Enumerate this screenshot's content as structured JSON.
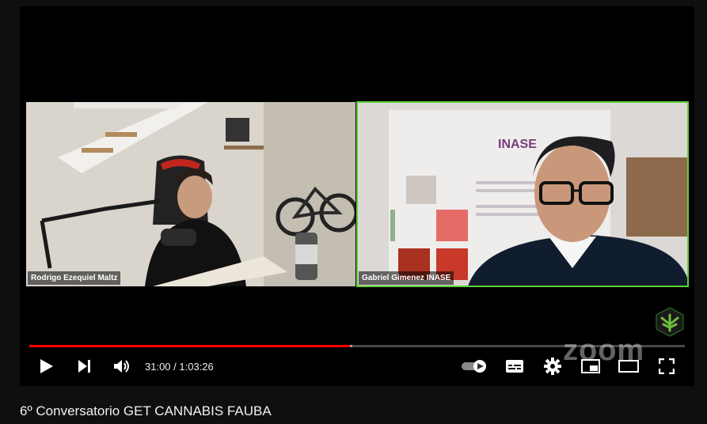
{
  "video": {
    "title": "6º Conversatorio GET CANNABIS FAUBA",
    "current_time": "31:00",
    "duration": "1:03:26",
    "time_separator": " / ",
    "progress_fraction": 0.4888,
    "buffered_fraction": 0.004,
    "watermark": "zoom"
  },
  "participants": [
    {
      "name": "Rodrigo Ezequiel Maltz"
    },
    {
      "name": "Gabriel Gimenez INASE"
    }
  ],
  "slide_logo": "INASE",
  "controls": {
    "play_icon": "play-icon",
    "next_icon": "skip-next-icon",
    "volume_icon": "volume-icon",
    "autoplay_icon": "autoplay-toggle-icon",
    "subtitles_icon": "subtitles-icon",
    "settings_icon": "gear-icon",
    "miniplayer_icon": "miniplayer-icon",
    "theater_icon": "theater-mode-icon",
    "fullscreen_icon": "fullscreen-icon"
  },
  "colors": {
    "progress": "#ff0000",
    "active_speaker": "#5ed03a",
    "background": "#0f0f0f"
  }
}
